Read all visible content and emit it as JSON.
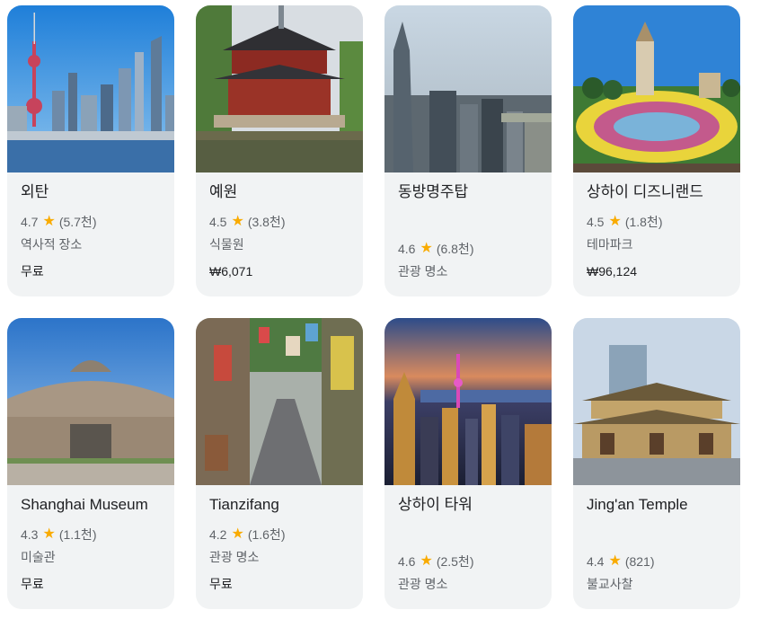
{
  "cards": [
    {
      "title": "외탄",
      "rating": "4.7",
      "reviews": "(5.7천)",
      "category": "역사적 장소",
      "price": "무료",
      "image": "bund-skyline"
    },
    {
      "title": "예원",
      "rating": "4.5",
      "reviews": "(3.8천)",
      "category": "식물원",
      "price": "₩6,071",
      "image": "yu-garden-pavilion"
    },
    {
      "title": "동방명주탑",
      "rating": "4.6",
      "reviews": "(6.8천)",
      "category": "관광 명소",
      "price": "",
      "image": "aerial-city"
    },
    {
      "title": "상하이 디즈니랜드",
      "rating": "4.5",
      "reviews": "(1.8천)",
      "category": "테마파크",
      "price": "₩96,124",
      "image": "disney-garden"
    },
    {
      "title": "Shanghai Museum",
      "rating": "4.3",
      "reviews": "(1.1천)",
      "category": "미술관",
      "price": "무료",
      "image": "museum-building"
    },
    {
      "title": "Tianzifang",
      "rating": "4.2",
      "reviews": "(1.6천)",
      "category": "관광 명소",
      "price": "무료",
      "image": "alley-street"
    },
    {
      "title": "상하이 타워",
      "rating": "4.6",
      "reviews": "(2.5천)",
      "category": "관광 명소",
      "price": "",
      "image": "night-skyline"
    },
    {
      "title": "Jing'an Temple",
      "rating": "4.4",
      "reviews": "(821)",
      "category": "불교사찰",
      "price": "",
      "image": "temple"
    }
  ],
  "colors": {
    "star": "#f9ab00",
    "card_bg": "#f1f3f4"
  }
}
